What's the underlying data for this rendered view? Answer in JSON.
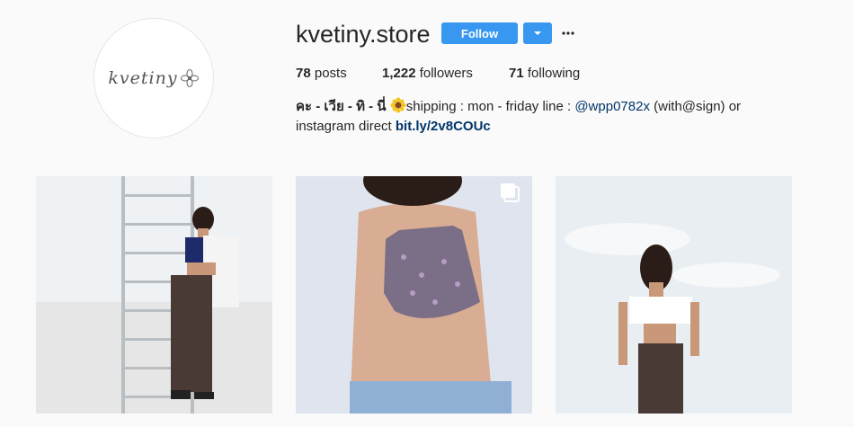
{
  "profile": {
    "username": "kvetiny.store",
    "avatar_text": "kvetiny",
    "follow_label": "Follow",
    "stats": {
      "posts_count": "78",
      "posts_label": "posts",
      "followers_count": "1,222",
      "followers_label": "followers",
      "following_count": "71",
      "following_label": "following"
    },
    "bio": {
      "name": "คะ - เวีย - ทิ - นี่",
      "text_part1": "shipping : mon - friday line : ",
      "mention": "@wpp0782x",
      "text_part2": " (with@sign) or instagram direct ",
      "link": "bit.ly/2v8COUc"
    }
  },
  "icons": {
    "dropdown": "chevron-down-icon",
    "more": "more-horizontal-icon",
    "sun": "sunflower-emoji-icon",
    "multi": "multiple-posts-icon"
  },
  "colors": {
    "accent": "#3897f0",
    "link": "#003569",
    "background": "#fafafa"
  }
}
